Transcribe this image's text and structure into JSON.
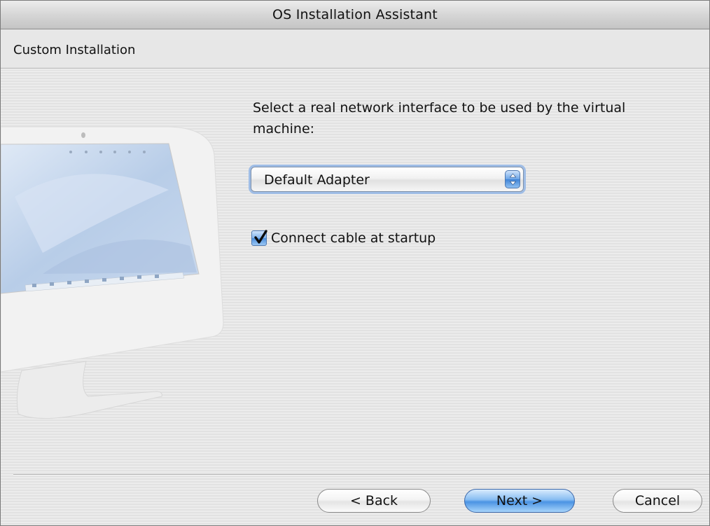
{
  "window": {
    "title": "OS Installation Assistant"
  },
  "header": {
    "title": "Custom Installation"
  },
  "main": {
    "prompt": "Select a real network interface to be used by the virtual machine:",
    "network_interface": {
      "selected": "Default Adapter",
      "icon": "popup-arrows-icon"
    },
    "connect_cable": {
      "label": "Connect cable at startup",
      "checked": true
    }
  },
  "footer": {
    "back_label": "< Back",
    "next_label": "Next >",
    "cancel_label": "Cancel"
  },
  "colors": {
    "accent_blue": "#4b93e3",
    "focus_ring": "#9fbde6",
    "stripe_light": "#ececec",
    "stripe_dark": "#e2e2e2"
  }
}
